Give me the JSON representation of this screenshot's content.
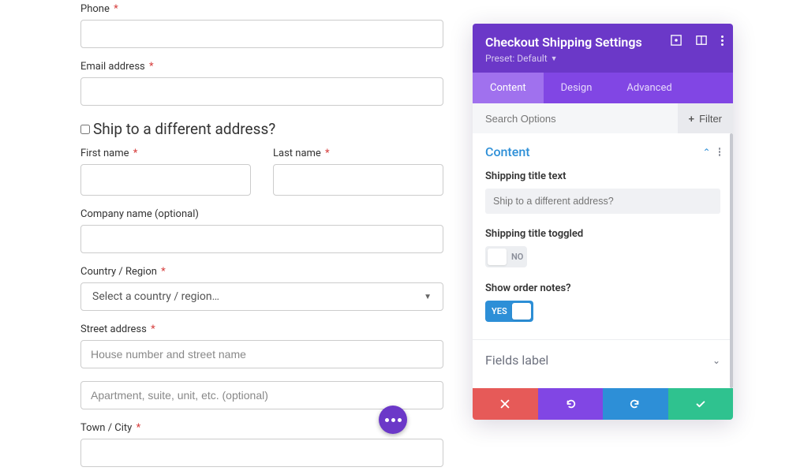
{
  "form": {
    "phone_label": "Phone",
    "email_label": "Email address",
    "ship_diff_label": "Ship to a different address?",
    "first_name_label": "First name",
    "last_name_label": "Last name",
    "company_label": "Company name (optional)",
    "country_label": "Country / Region",
    "country_placeholder": "Select a country / region…",
    "street_label": "Street address",
    "street1_placeholder": "House number and street name",
    "street2_placeholder": "Apartment, suite, unit, etc. (optional)",
    "city_label": "Town / City",
    "required_mark": "*"
  },
  "panel": {
    "title": "Checkout Shipping Settings",
    "preset_label": "Preset: Default",
    "tabs": {
      "content": "Content",
      "design": "Design",
      "advanced": "Advanced"
    },
    "search_placeholder": "Search Options",
    "filter_label": "Filter",
    "section_content": "Content",
    "opts": {
      "shipping_title_text_label": "Shipping title text",
      "shipping_title_text_placeholder": "Ship to a different address?",
      "shipping_title_toggled_label": "Shipping title toggled",
      "show_order_notes_label": "Show order notes?"
    },
    "toggle": {
      "no": "NO",
      "yes": "YES"
    },
    "collapsed_fields_label": "Fields label"
  }
}
